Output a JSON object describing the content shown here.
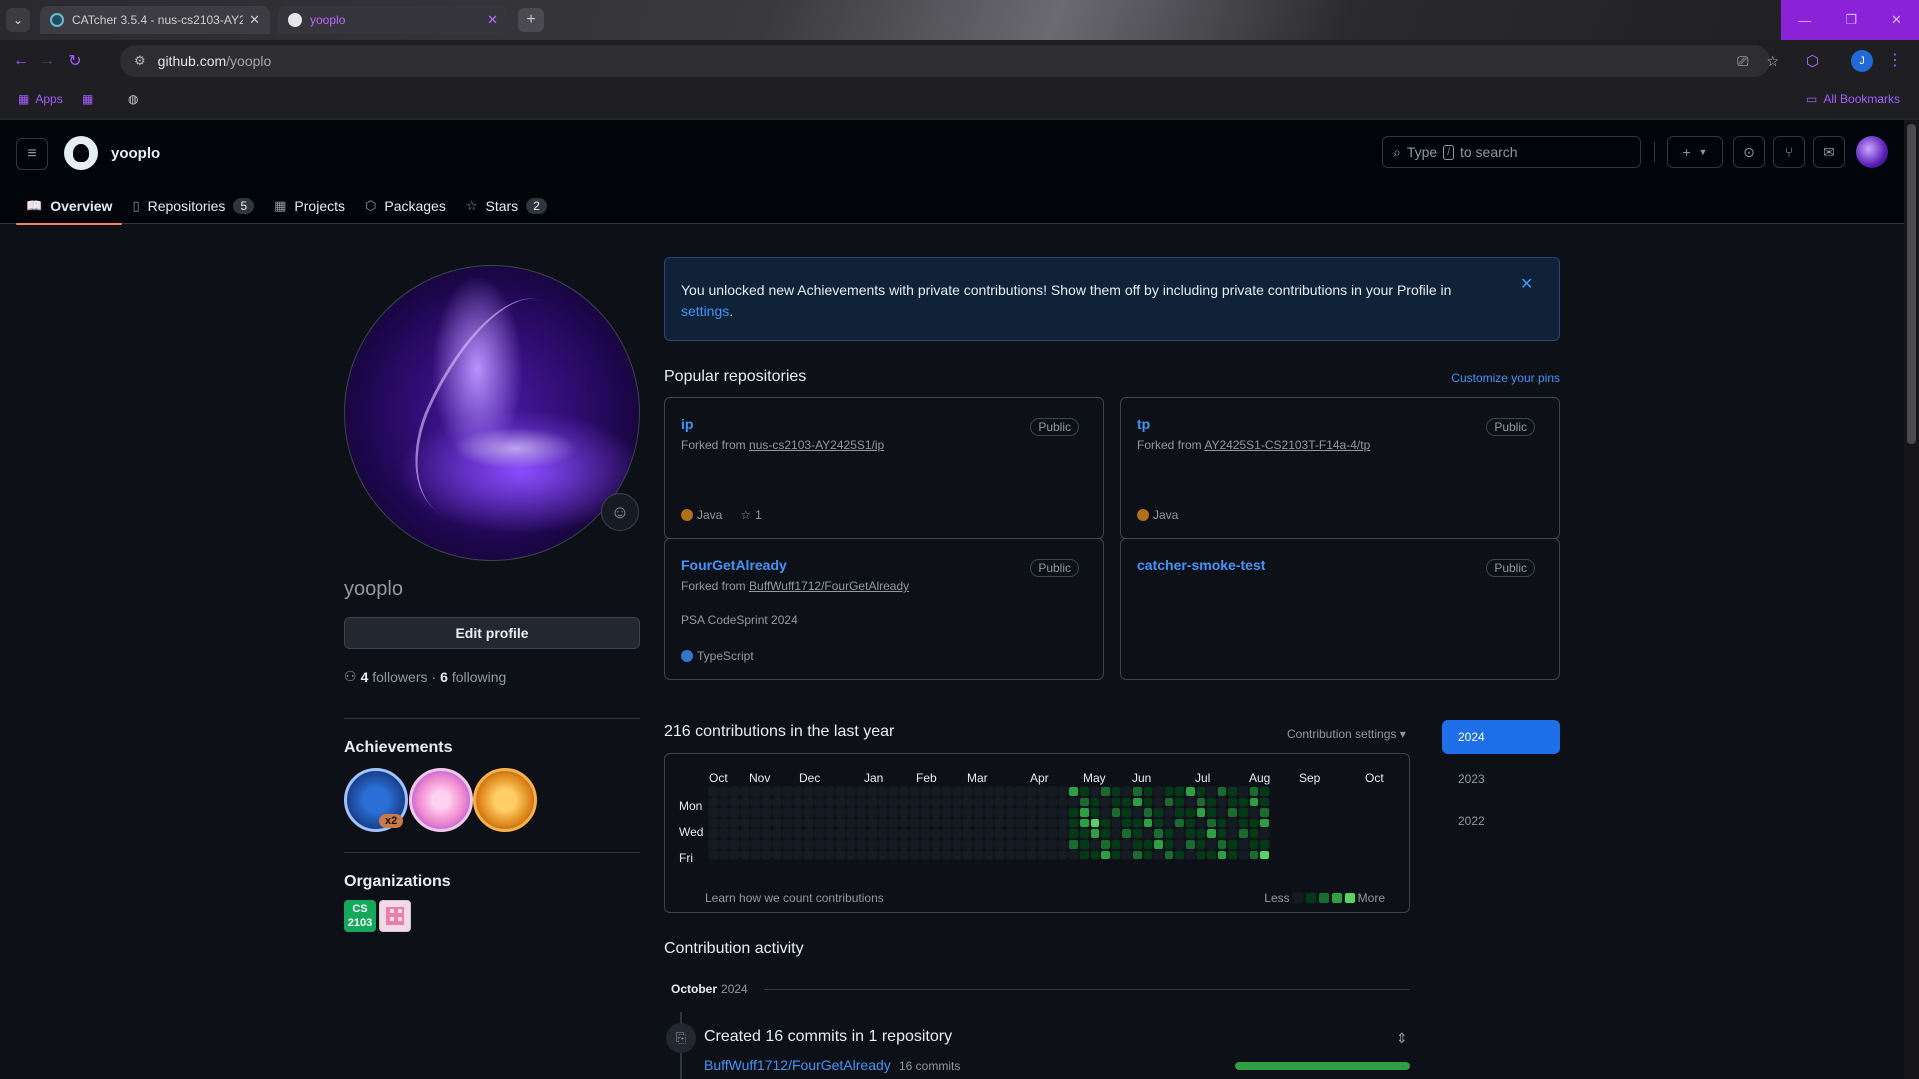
{
  "browser": {
    "tabs": [
      {
        "title": "CATcher 3.5.4 - nus-cs2103-AY2",
        "active": false
      },
      {
        "title": "yooplo",
        "active": true
      }
    ],
    "url_host": "github.com",
    "url_path": "/yooplo",
    "profile_initial": "J",
    "bookmarks": {
      "apps": "Apps",
      "all": "All Bookmarks"
    }
  },
  "header": {
    "username": "yooplo",
    "search": {
      "prefix": "Type",
      "key": "/",
      "suffix": "to search"
    },
    "tabs": [
      {
        "label": "Overview",
        "icon": "book-icon",
        "active": true
      },
      {
        "label": "Repositories",
        "icon": "repo-icon",
        "count": "5"
      },
      {
        "label": "Projects",
        "icon": "table-icon"
      },
      {
        "label": "Packages",
        "icon": "package-icon"
      },
      {
        "label": "Stars",
        "icon": "star-icon",
        "count": "2"
      }
    ]
  },
  "profile": {
    "login": "yooplo",
    "edit_label": "Edit profile",
    "followers_count": "4",
    "followers_label": "followers",
    "sep": "·",
    "following_count": "6",
    "following_label": "following",
    "achievements_title": "Achievements",
    "achievement_multiplier": "x2",
    "organizations_title": "Organizations",
    "org1_label": "CS 2103"
  },
  "flash": {
    "text": "You unlocked new Achievements with private contributions! Show them off by including private contributions in your Profile in",
    "link": "settings",
    "end": "."
  },
  "popular": {
    "title": "Popular repositories",
    "customize": "Customize your pins",
    "repos": [
      {
        "name": "ip",
        "visibility": "Public",
        "fork_prefix": "Forked from",
        "fork_source": "nus-cs2103-AY2425S1/ip",
        "language": "Java",
        "lang_color": "#b07219",
        "stars": "1"
      },
      {
        "name": "tp",
        "visibility": "Public",
        "fork_prefix": "Forked from",
        "fork_source": "AY2425S1-CS2103T-F14a-4/tp",
        "language": "Java",
        "lang_color": "#b07219"
      },
      {
        "name": "FourGetAlready",
        "visibility": "Public",
        "fork_prefix": "Forked from",
        "fork_source": "BuffWuff1712/FourGetAlready",
        "description": "PSA CodeSprint 2024",
        "language": "TypeScript",
        "lang_color": "#3178c6"
      },
      {
        "name": "catcher-smoke-test",
        "visibility": "Public"
      }
    ]
  },
  "contributions": {
    "title": "216 contributions in the last year",
    "settings": "Contribution settings ▾",
    "months": [
      "Oct",
      "Nov",
      "Dec",
      "Jan",
      "Feb",
      "Mar",
      "Apr",
      "May",
      "Jun",
      "Jul",
      "Aug",
      "Sep",
      "Oct"
    ],
    "days": [
      "Mon",
      "Wed",
      "Fri"
    ],
    "learn": "Learn how we count contributions",
    "less": "Less",
    "more": "More",
    "years": [
      "2024",
      "2023",
      "2022"
    ],
    "colors": [
      "#151b23",
      "#033a16",
      "#196c2e",
      "#2ea043",
      "#56d364"
    ]
  },
  "activity": {
    "title": "Contribution activity",
    "month": "October",
    "year": "2024",
    "item_title": "Created 16 commits in 1 repository",
    "repo": "BuffWuff1712/FourGetAlready",
    "commits": "16 commits"
  }
}
